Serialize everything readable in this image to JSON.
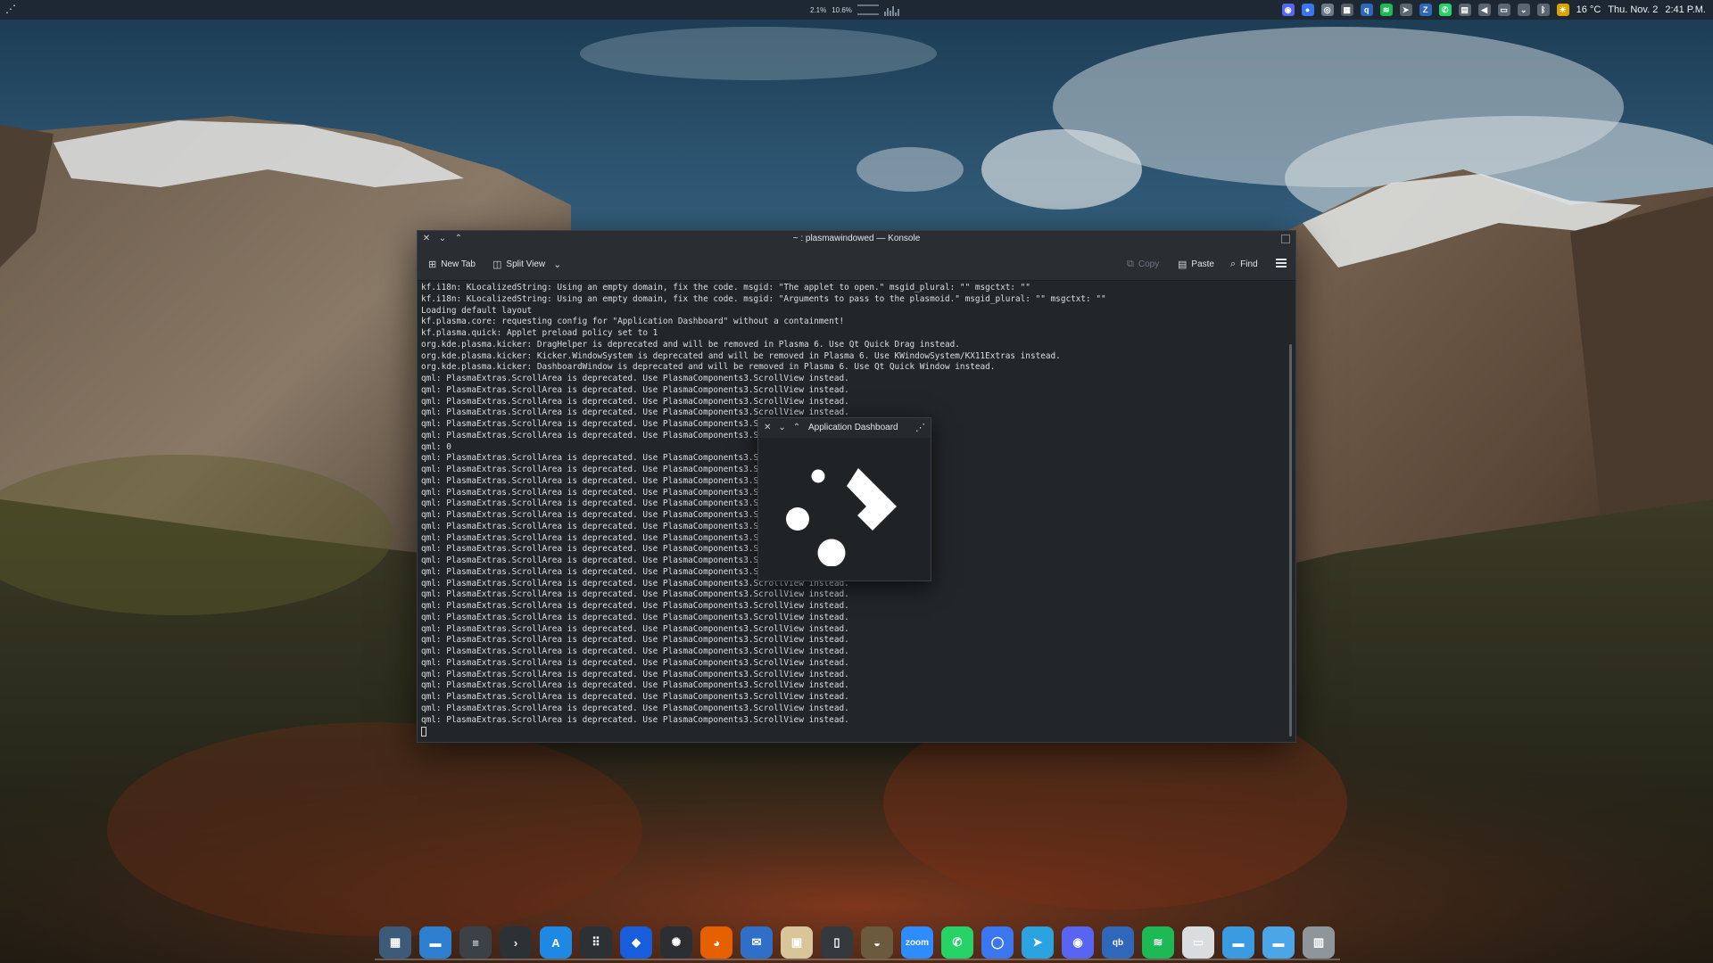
{
  "top_panel": {
    "launcher_icon": "kde-launcher-icon",
    "sysmon": {
      "cpu": "2.1%",
      "mem": "10.6%"
    },
    "tray_icons": [
      {
        "name": "discord-tray-icon",
        "glyph": "◉",
        "color": "#5865f2"
      },
      {
        "name": "signal-tray-icon",
        "glyph": "●",
        "color": "#3a76f0"
      },
      {
        "name": "chatgpt-tray-icon",
        "glyph": "◎",
        "color": "#6b7b86"
      },
      {
        "name": "calculator-tray-icon",
        "glyph": "▦",
        "color": "#55606a"
      },
      {
        "name": "qbittorrent-tray-icon",
        "glyph": "q",
        "color": "#2f67ba"
      },
      {
        "name": "spotify-tray-icon",
        "glyph": "≋",
        "color": "#1db954"
      },
      {
        "name": "telegram-tray-icon",
        "glyph": "➤",
        "color": "#5b6770"
      },
      {
        "name": "zulip-tray-icon",
        "glyph": "Z",
        "color": "#2f67ba"
      },
      {
        "name": "whatsapp-tray-icon",
        "glyph": "✆",
        "color": "#25d366"
      },
      {
        "name": "clipboard-tray-icon",
        "glyph": "▤",
        "color": "#5b6770"
      },
      {
        "name": "volume-tray-icon",
        "glyph": "◀",
        "color": "#5b6770"
      },
      {
        "name": "display-tray-icon",
        "glyph": "▭",
        "color": "#5b6770"
      },
      {
        "name": "expand-tray-icon",
        "glyph": "⌄",
        "color": "#5b6770"
      },
      {
        "name": "bluetooth-tray-icon",
        "glyph": "ᛒ",
        "color": "#5b6770"
      },
      {
        "name": "weather-tray-icon",
        "glyph": "☀",
        "color": "#d9a400"
      }
    ],
    "temperature": "16 °C",
    "date": "Thu. Nov. 2",
    "time": "2:41 P.M."
  },
  "konsole": {
    "title": "~ : plasmawindowed — Konsole",
    "toolbar": {
      "new_tab": "New Tab",
      "split_view": "Split View",
      "copy": "Copy",
      "paste": "Paste",
      "find": "Find"
    },
    "lines": [
      "kf.i18n: KLocalizedString: Using an empty domain, fix the code. msgid: \"The applet to open.\" msgid_plural: \"\" msgctxt: \"\"",
      "kf.i18n: KLocalizedString: Using an empty domain, fix the code. msgid: \"Arguments to pass to the plasmoid.\" msgid_plural: \"\" msgctxt: \"\"",
      "Loading default layout",
      "kf.plasma.core: requesting config for \"Application Dashboard\" without a containment!",
      "kf.plasma.quick: Applet preload policy set to 1",
      "org.kde.plasma.kicker: DragHelper is deprecated and will be removed in Plasma 6. Use Qt Quick Drag instead.",
      "org.kde.plasma.kicker: Kicker.WindowSystem is deprecated and will be removed in Plasma 6. Use KWindowSystem/KX11Extras instead.",
      "org.kde.plasma.kicker: DashboardWindow is deprecated and will be removed in Plasma 6. Use Qt Quick Window instead.",
      "qml: PlasmaExtras.ScrollArea is deprecated. Use PlasmaComponents3.ScrollView instead.",
      "qml: PlasmaExtras.ScrollArea is deprecated. Use PlasmaComponents3.ScrollView instead.",
      "qml: PlasmaExtras.ScrollArea is deprecated. Use PlasmaComponents3.ScrollView instead.",
      "qml: PlasmaExtras.ScrollArea is deprecated. Use PlasmaComponents3.ScrollView instead.",
      "qml: PlasmaExtras.ScrollArea is deprecated. Use PlasmaComponents3.ScrollView instead.",
      "qml: PlasmaExtras.ScrollArea is deprecated. Use PlasmaComponents3.ScrollView instead.",
      "qml: 0",
      "qml: PlasmaExtras.ScrollArea is deprecated. Use PlasmaComponents3.ScrollView instead.",
      "qml: PlasmaExtras.ScrollArea is deprecated. Use PlasmaComponents3.ScrollView instead.",
      "qml: PlasmaExtras.ScrollArea is deprecated. Use PlasmaComponents3.ScrollView instead.",
      "qml: PlasmaExtras.ScrollArea is deprecated. Use PlasmaComponents3.ScrollView instead.",
      "qml: PlasmaExtras.ScrollArea is deprecated. Use PlasmaComponents3.ScrollView instead.",
      "qml: PlasmaExtras.ScrollArea is deprecated. Use PlasmaComponents3.ScrollView instead.",
      "qml: PlasmaExtras.ScrollArea is deprecated. Use PlasmaComponents3.ScrollView instead.",
      "qml: PlasmaExtras.ScrollArea is deprecated. Use PlasmaComponents3.ScrollView instead.",
      "qml: PlasmaExtras.ScrollArea is deprecated. Use PlasmaComponents3.ScrollView instead.",
      "qml: PlasmaExtras.ScrollArea is deprecated. Use PlasmaComponents3.ScrollView instead.",
      "qml: PlasmaExtras.ScrollArea is deprecated. Use PlasmaComponents3.ScrollView instead.",
      "qml: PlasmaExtras.ScrollArea is deprecated. Use PlasmaComponents3.ScrollView instead.",
      "qml: PlasmaExtras.ScrollArea is deprecated. Use PlasmaComponents3.ScrollView instead.",
      "qml: PlasmaExtras.ScrollArea is deprecated. Use PlasmaComponents3.ScrollView instead.",
      "qml: PlasmaExtras.ScrollArea is deprecated. Use PlasmaComponents3.ScrollView instead.",
      "qml: PlasmaExtras.ScrollArea is deprecated. Use PlasmaComponents3.ScrollView instead.",
      "qml: PlasmaExtras.ScrollArea is deprecated. Use PlasmaComponents3.ScrollView instead.",
      "qml: PlasmaExtras.ScrollArea is deprecated. Use PlasmaComponents3.ScrollView instead.",
      "qml: PlasmaExtras.ScrollArea is deprecated. Use PlasmaComponents3.ScrollView instead.",
      "qml: PlasmaExtras.ScrollArea is deprecated. Use PlasmaComponents3.ScrollView instead.",
      "qml: PlasmaExtras.ScrollArea is deprecated. Use PlasmaComponents3.ScrollView instead.",
      "qml: PlasmaExtras.ScrollArea is deprecated. Use PlasmaComponents3.ScrollView instead.",
      "qml: PlasmaExtras.ScrollArea is deprecated. Use PlasmaComponents3.ScrollView instead.",
      "qml: PlasmaExtras.ScrollArea is deprecated. Use PlasmaComponents3.ScrollView instead."
    ]
  },
  "dashboard_popup": {
    "title": "Application Dashboard"
  },
  "dock": [
    {
      "name": "overview-dock-icon",
      "glyph": "▦",
      "bg": "#3d5a78"
    },
    {
      "name": "files-dock-icon",
      "glyph": "▬",
      "bg": "#2f7fd0"
    },
    {
      "name": "system-settings-dock-icon",
      "glyph": "≡",
      "bg": "#3b4147"
    },
    {
      "name": "terminal-dock-icon",
      "glyph": "›",
      "bg": "#2c3136"
    },
    {
      "name": "app-store-dock-icon",
      "glyph": "A",
      "bg": "#1e88e5"
    },
    {
      "name": "app-grid-dock-icon",
      "glyph": "⠿",
      "bg": "#2c3136"
    },
    {
      "name": "bitwarden-dock-icon",
      "glyph": "◆",
      "bg": "#175ddc"
    },
    {
      "name": "chatgpt-dock-icon",
      "glyph": "✺",
      "bg": "#2b2f33"
    },
    {
      "name": "firefox-dock-icon",
      "glyph": "◕",
      "bg": "#e66000"
    },
    {
      "name": "thunderbird-dock-icon",
      "glyph": "✉",
      "bg": "#2f6fc7"
    },
    {
      "name": "gallery-dock-icon",
      "glyph": "▣",
      "bg": "#d8c59a"
    },
    {
      "name": "notes-dock-icon",
      "glyph": "▯",
      "bg": "#34393e"
    },
    {
      "name": "gimp-dock-icon",
      "glyph": "◒",
      "bg": "#6b5a3e"
    },
    {
      "name": "zoom-dock-icon",
      "glyph": "zoom",
      "bg": "#2d8cff"
    },
    {
      "name": "whatsapp-dock-icon",
      "glyph": "✆",
      "bg": "#25d366"
    },
    {
      "name": "signal-dock-icon",
      "glyph": "◯",
      "bg": "#3a76f0"
    },
    {
      "name": "telegram-dock-icon",
      "glyph": "➤",
      "bg": "#2aa3e0"
    },
    {
      "name": "discord-dock-icon",
      "glyph": "◉",
      "bg": "#5865f2"
    },
    {
      "name": "qbittorrent-dock-icon",
      "glyph": "qb",
      "bg": "#2f67ba"
    },
    {
      "name": "spotify-dock-icon",
      "glyph": "≋",
      "bg": "#1db954"
    },
    {
      "name": "blank-window-dock-icon",
      "glyph": "▭",
      "bg": "#d9dde0"
    },
    {
      "name": "folder-dock-icon",
      "glyph": "▬",
      "bg": "#3b9be0"
    },
    {
      "name": "home-folder-dock-icon",
      "glyph": "▬",
      "bg": "#4aa6e6"
    },
    {
      "name": "trash-dock-icon",
      "glyph": "▥",
      "bg": "#8e969c"
    }
  ]
}
